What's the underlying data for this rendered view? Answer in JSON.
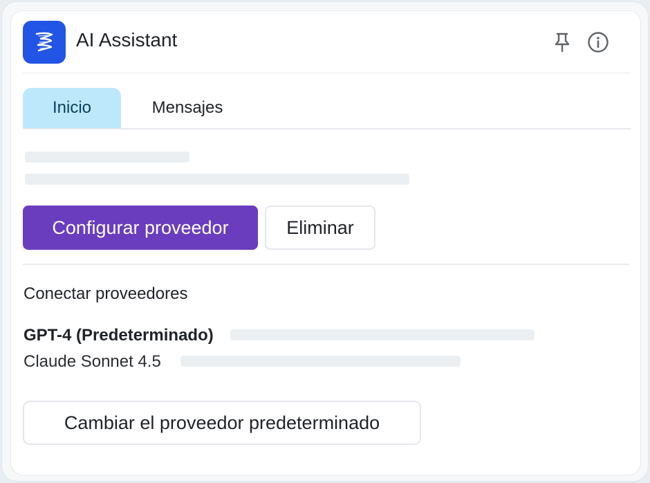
{
  "header": {
    "app_title": "AI Assistant",
    "logo_icon": "ribbon-logo-icon",
    "pin_icon": "pin-icon",
    "info_icon": "info-icon",
    "brand_color": "#2255e6"
  },
  "tabs": [
    {
      "label": "Inicio",
      "active": true
    },
    {
      "label": "Mensajes",
      "active": false
    }
  ],
  "actions": {
    "configure_label": "Configurar proveedor",
    "delete_label": "Eliminar",
    "primary_color": "#6a3dbf"
  },
  "providers_section": {
    "title": "Conectar proveedores",
    "items": [
      {
        "label": "GPT-4 (Predeterminado)",
        "is_default": true
      },
      {
        "label": "Claude Sonnet 4.5",
        "is_default": false
      }
    ]
  },
  "footer_action": {
    "change_default_label": "Cambiar el proveedor predeterminado"
  }
}
